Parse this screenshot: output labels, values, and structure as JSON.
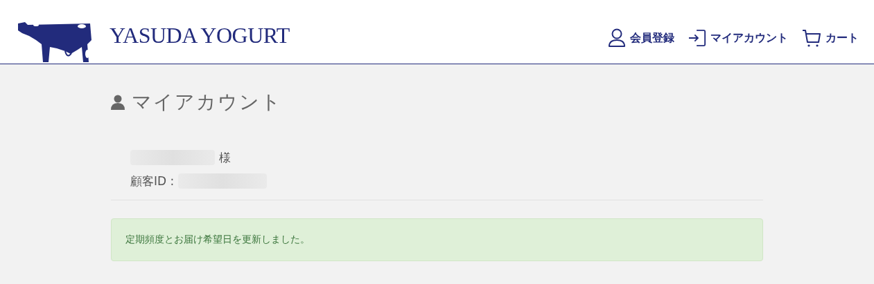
{
  "header": {
    "logo_text": "YASUDA YOGURT",
    "nav": [
      {
        "kind": "register",
        "label": "会員登録"
      },
      {
        "kind": "account",
        "label": "マイアカウント"
      },
      {
        "kind": "cart",
        "label": "カート"
      }
    ]
  },
  "page": {
    "title": "マイアカウント",
    "customer_suffix": "様",
    "customer_id_label": "顧客ID :"
  },
  "alert": {
    "message": "定期頻度とお届け希望日を更新しました。"
  }
}
